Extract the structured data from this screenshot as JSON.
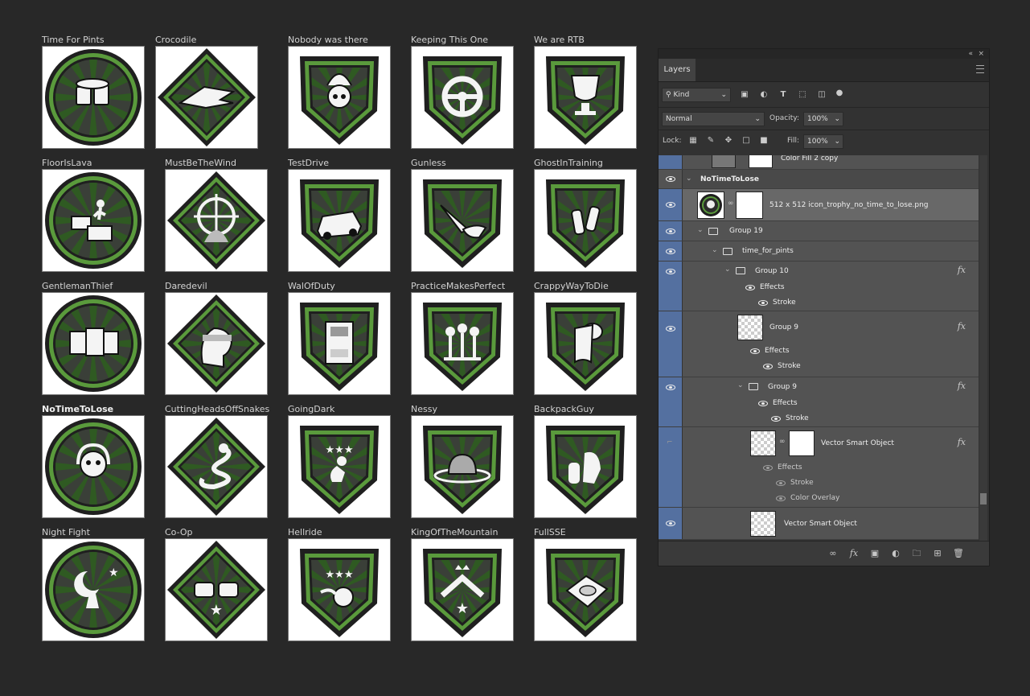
{
  "icons": [
    {
      "label": "Time For Pints",
      "icon": "beer-mugs-icon"
    },
    {
      "label": "Crocodile",
      "icon": "crocodile-icon"
    },
    {
      "label": "Nobody was there",
      "icon": "flaming-skull-icon"
    },
    {
      "label": "Keeping This One",
      "icon": "steering-wheel-icon"
    },
    {
      "label": "We are RTB",
      "icon": "trophy-cup-icon"
    },
    {
      "label": "FloorIsLava",
      "icon": "crates-jump-icon"
    },
    {
      "label": "MustBeTheWind",
      "icon": "crosshair-target-icon"
    },
    {
      "label": "TestDrive",
      "icon": "car-icon"
    },
    {
      "label": "Gunless",
      "icon": "knife-hand-icon"
    },
    {
      "label": "GhostInTraining",
      "icon": "bottles-icon"
    },
    {
      "label": "GentlemanThief",
      "icon": "safes-icon"
    },
    {
      "label": "Daredevil",
      "icon": "bandana-head-icon"
    },
    {
      "label": "WalOfDuty",
      "icon": "vending-machine-icon"
    },
    {
      "label": "PracticeMakesPerfect",
      "icon": "shooting-targets-icon"
    },
    {
      "label": "CrappyWayToDie",
      "icon": "toilet-paper-icon"
    },
    {
      "label": "NoTimeToLose",
      "icon": "headset-skull-icon"
    },
    {
      "label": "CuttingHeadsOffSnakes",
      "icon": "snake-icon"
    },
    {
      "label": "GoingDark",
      "icon": "crouching-figure-icon"
    },
    {
      "label": "Nessy",
      "icon": "creature-head-icon"
    },
    {
      "label": "BackpackGuy",
      "icon": "bottles-backpack-icon"
    },
    {
      "label": "Night Fight",
      "icon": "moon-stars-figure-icon"
    },
    {
      "label": "Co-Op",
      "icon": "fist-bump-icon"
    },
    {
      "label": "Hellride",
      "icon": "flaming-wheel-icon"
    },
    {
      "label": "KingOfTheMountain",
      "icon": "crown-mountain-icon"
    },
    {
      "label": "FullSSE",
      "icon": "hard-drive-icon"
    }
  ],
  "layers_panel": {
    "tab_label": "Layers",
    "collapse_glyph": "«",
    "close_glyph": "×",
    "filter_kind": "Kind",
    "blend_mode": "Normal",
    "opacity_label": "Opacity:",
    "opacity_value": "100%",
    "lock_label": "Lock:",
    "fill_label": "Fill:",
    "fill_value": "100%",
    "layers": {
      "r0": "Color Fill 2 copy",
      "r1": "NoTimeToLose",
      "r2": "512 x 512 icon_trophy_no_time_to_lose.png",
      "r3": "Group 19",
      "r4": "time_for_pints",
      "r5": "Group 10",
      "r6": "Effects",
      "r7": "Stroke",
      "r8": "Group 9",
      "r9": "Effects",
      "r10": "Stroke",
      "r11": "Group 9",
      "r12": "Effects",
      "r13": "Stroke",
      "r14": "Vector Smart Object",
      "r15": "Effects",
      "r16": "Stroke",
      "r17": "Color Overlay",
      "r18": "Vector Smart Object"
    },
    "fx_glyph": "fx"
  },
  "colors": {
    "badge_dark": "#1f1f1f",
    "badge_green": "#5a9a3c",
    "badge_mid": "#3a3f38",
    "panel_bg": "#323232",
    "selected_column": "#5470a0"
  }
}
